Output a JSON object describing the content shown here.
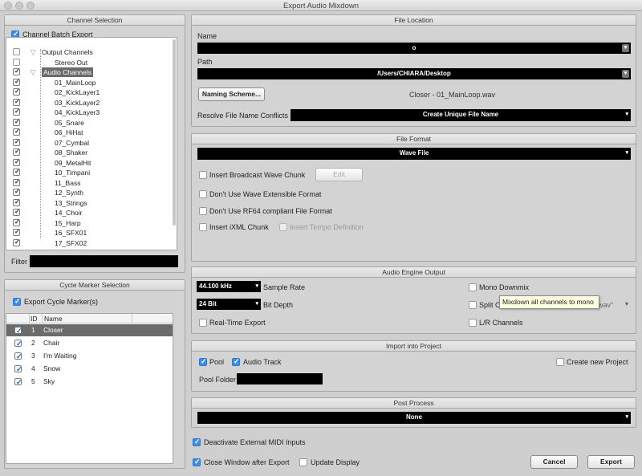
{
  "window": {
    "title": "Export Audio Mixdown"
  },
  "channel_selection": {
    "title": "Channel Selection",
    "batch_export_label": "Channel Batch Export",
    "batch_export_checked": true,
    "tree": [
      {
        "label": "Output Channels",
        "level": 0,
        "checked": false,
        "expander": true
      },
      {
        "label": "Stereo Out",
        "level": 1,
        "checked": false
      },
      {
        "label": "Audio Channels",
        "level": 0,
        "checked": true,
        "expander": true,
        "selected": true
      },
      {
        "label": "01_MainLoop",
        "level": 1,
        "checked": true
      },
      {
        "label": "02_KickLayer1",
        "level": 1,
        "checked": true
      },
      {
        "label": "03_KickLayer2",
        "level": 1,
        "checked": true
      },
      {
        "label": "04_KickLayer3",
        "level": 1,
        "checked": true
      },
      {
        "label": "05_Snare",
        "level": 1,
        "checked": true
      },
      {
        "label": "06_HiHat",
        "level": 1,
        "checked": true
      },
      {
        "label": "07_Cymbal",
        "level": 1,
        "checked": true
      },
      {
        "label": "08_Shaker",
        "level": 1,
        "checked": true
      },
      {
        "label": "09_MetalHit",
        "level": 1,
        "checked": true
      },
      {
        "label": "10_Timpani",
        "level": 1,
        "checked": true
      },
      {
        "label": "11_Bass",
        "level": 1,
        "checked": true
      },
      {
        "label": "12_Synth",
        "level": 1,
        "checked": true
      },
      {
        "label": "13_Strings",
        "level": 1,
        "checked": true
      },
      {
        "label": "14_Choir",
        "level": 1,
        "checked": true
      },
      {
        "label": "15_Harp",
        "level": 1,
        "checked": true
      },
      {
        "label": "16_SFX01",
        "level": 1,
        "checked": true
      },
      {
        "label": "17_SFX02",
        "level": 1,
        "checked": true
      }
    ],
    "filter_label": "Filter",
    "filter_value": ""
  },
  "cycle_marker_selection": {
    "title": "Cycle Marker Selection",
    "export_label": "Export Cycle Marker(s)",
    "export_checked": true,
    "columns": {
      "id": "ID",
      "name": "Name"
    },
    "markers": [
      {
        "id": "1",
        "name": "Closer",
        "checked": true,
        "selected": true
      },
      {
        "id": "2",
        "name": "Chair",
        "checked": true
      },
      {
        "id": "3",
        "name": "I'm Waiting",
        "checked": true
      },
      {
        "id": "4",
        "name": "Snow",
        "checked": true
      },
      {
        "id": "5",
        "name": "Sky",
        "checked": true
      }
    ]
  },
  "file_location": {
    "title": "File Location",
    "name_label": "Name",
    "name_value": "o",
    "path_label": "Path",
    "path_value": "/Users/CHIARA/Desktop",
    "naming_scheme_button": "Naming Scheme...",
    "preview_filename": "Closer - 01_MainLoop.wav",
    "resolve_label": "Resolve File Name Conflicts",
    "resolve_value": "Create Unique File Name"
  },
  "file_format": {
    "title": "File Format",
    "format_value": "Wave File",
    "broadcast_label": "Insert Broadcast Wave Chunk",
    "edit_button": "Edit",
    "extensible_label": "Don't Use Wave Extensible Format",
    "rf64_label": "Don't Use RF64 compliant File Format",
    "ixml_label": "Insert iXML Chunk",
    "tempo_label": "Insert Tempo Definition"
  },
  "audio_engine_output": {
    "title": "Audio Engine Output",
    "sample_rate_value": "44.100 kHz",
    "sample_rate_label": "Sample Rate",
    "bit_depth_value": "24 Bit",
    "bit_depth_label": "Bit Depth",
    "realtime_label": "Real-Time Export",
    "mono_downmix_label": "Mono Downmix",
    "split_label": "Split C",
    "split_suffix": "wav\"",
    "lr_label": "L/R Channels",
    "tooltip": "Mixdown all channels to mono"
  },
  "import_into_project": {
    "title": "Import into Project",
    "pool_label": "Pool",
    "pool_checked": true,
    "audio_track_label": "Audio Track",
    "audio_track_checked": true,
    "new_project_label": "Create new Project",
    "new_project_checked": false,
    "pool_folder_label": "Pool Folder",
    "pool_folder_value": ""
  },
  "post_process": {
    "title": "Post Process",
    "value": "None"
  },
  "footer": {
    "deactivate_midi_label": "Deactivate External MIDI Inputs",
    "deactivate_midi_checked": true,
    "close_window_label": "Close Window after Export",
    "close_window_checked": true,
    "update_display_label": "Update Display",
    "update_display_checked": false,
    "cancel_button": "Cancel",
    "export_button": "Export"
  }
}
